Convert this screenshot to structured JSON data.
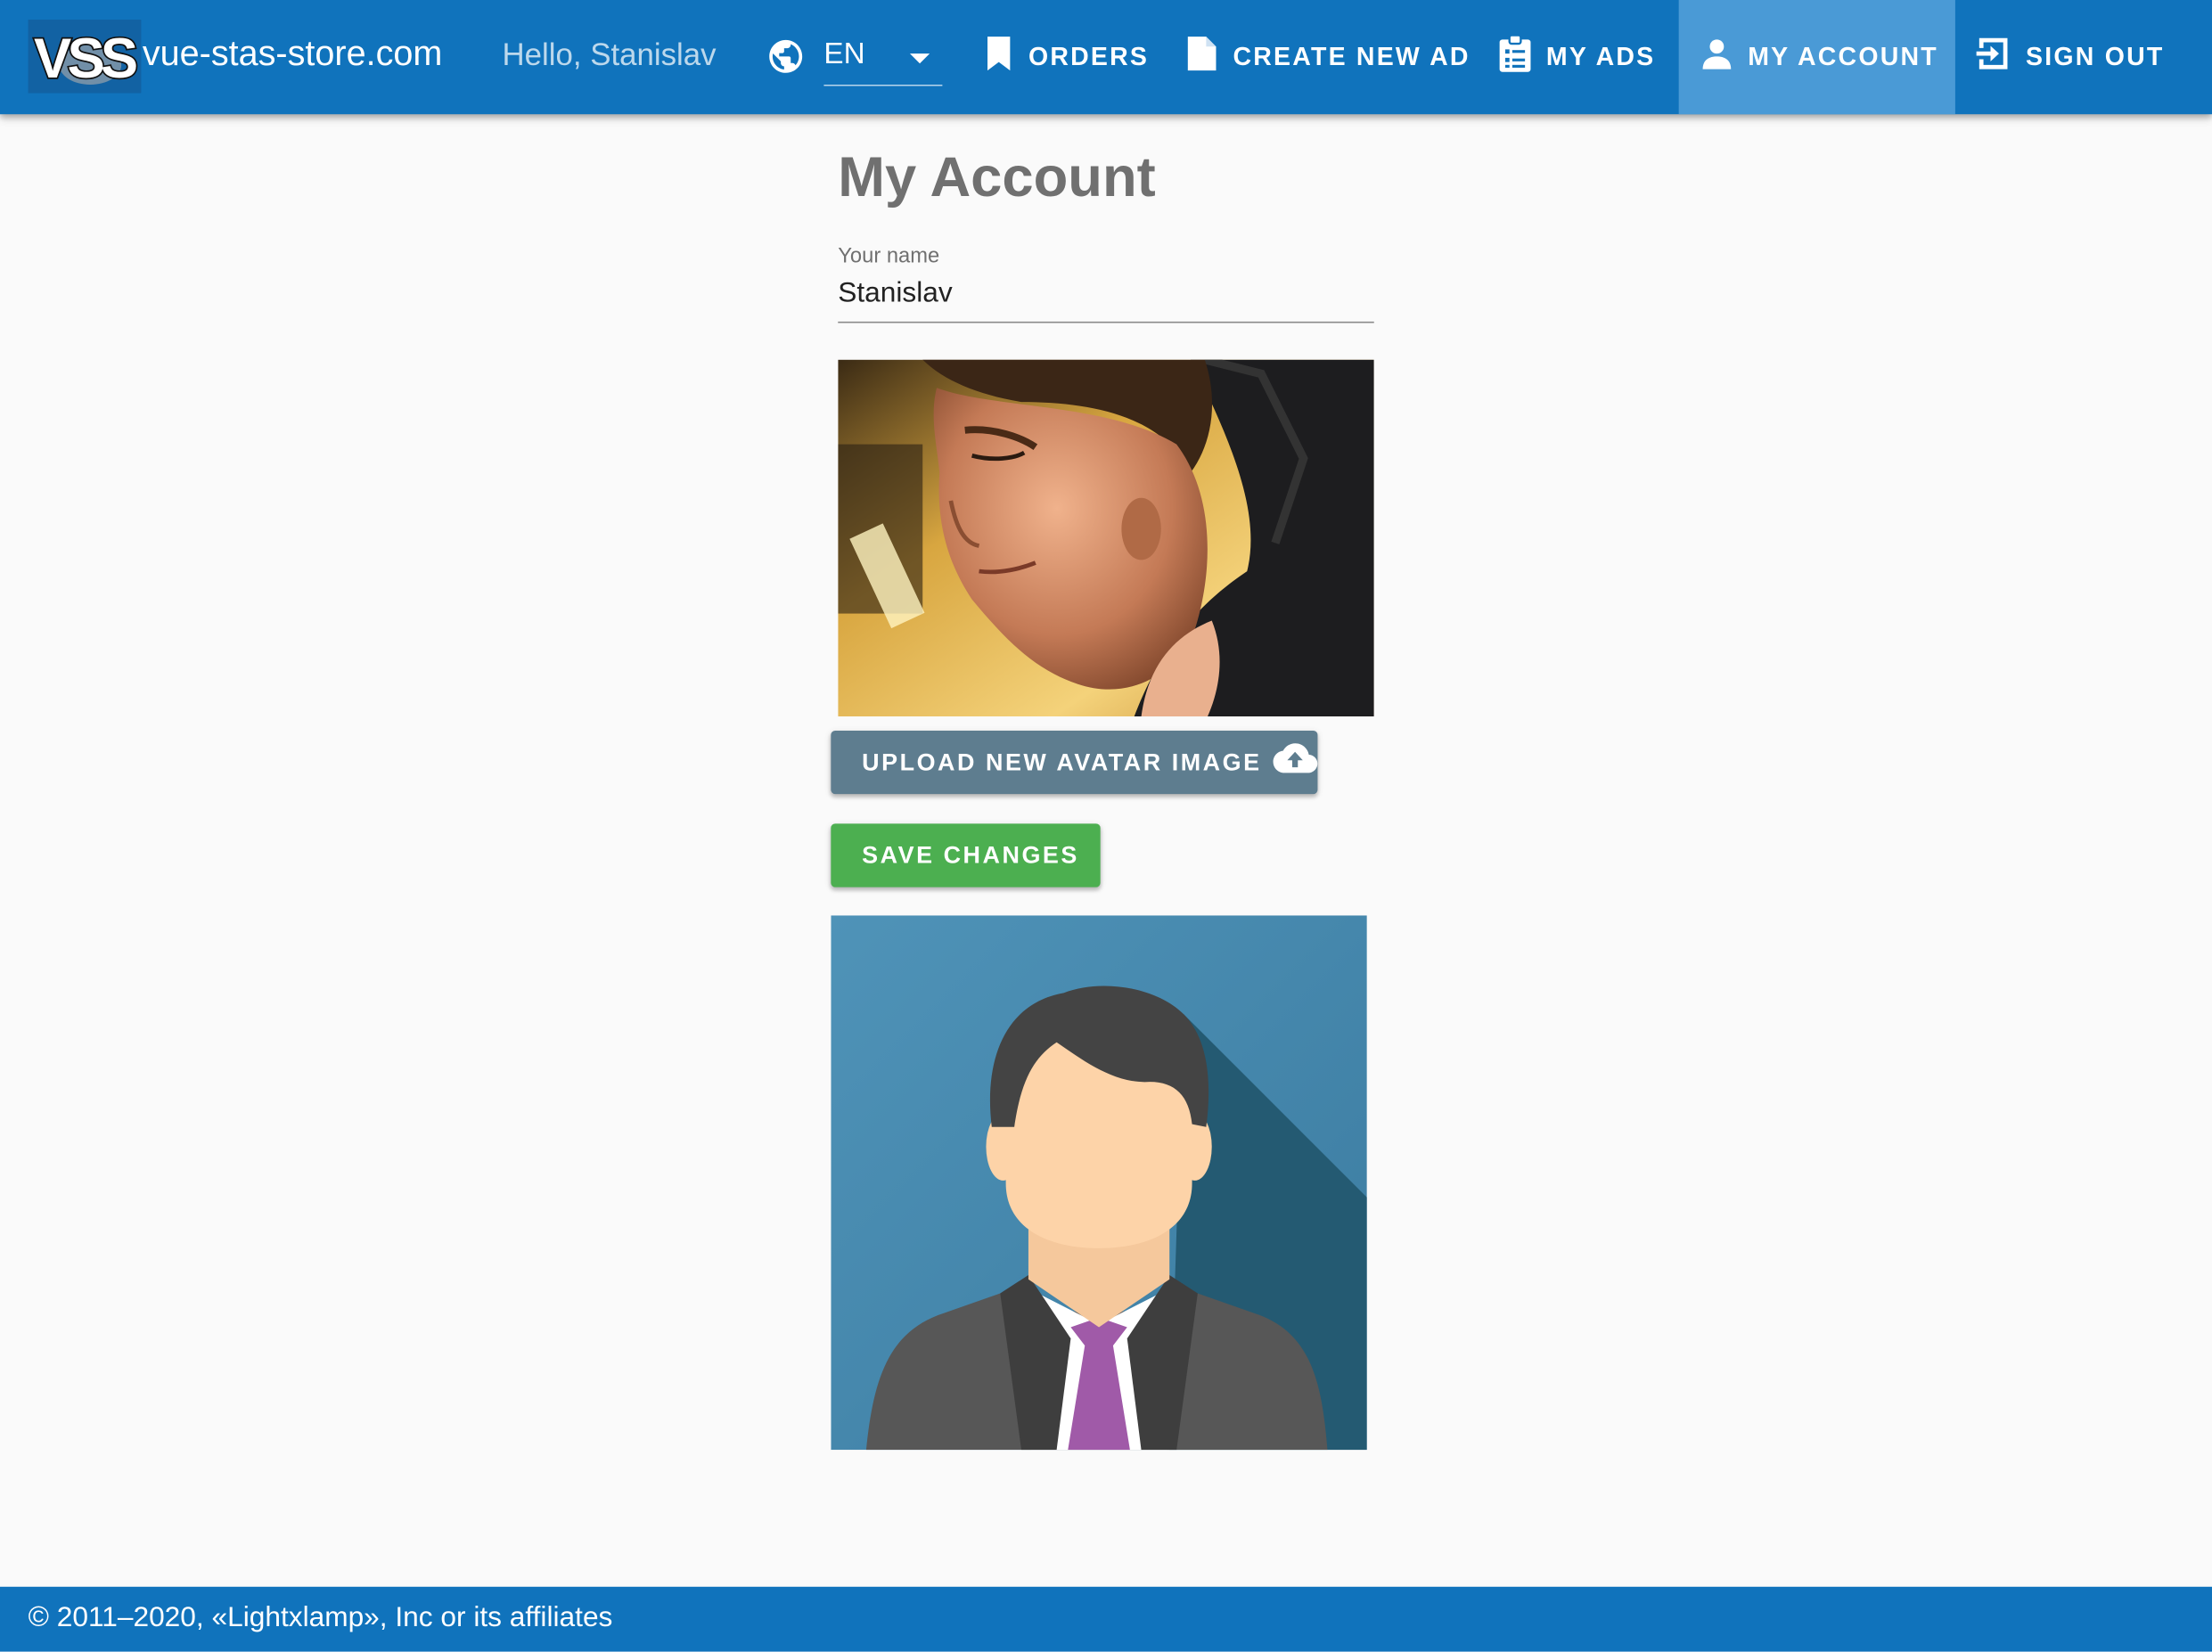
{
  "header": {
    "logo_text": "VSS",
    "brand": "vue-stas-store.com",
    "greeting": "Hello, Stanislav",
    "language": {
      "selected": "EN"
    },
    "nav": [
      {
        "label": "ORDERS",
        "icon": "bookmark-icon"
      },
      {
        "label": "CREATE NEW AD",
        "icon": "file-icon"
      },
      {
        "label": "MY ADS",
        "icon": "clipboard-list-icon"
      },
      {
        "label": "MY ACCOUNT",
        "icon": "account-icon",
        "active": true
      },
      {
        "label": "SIGN OUT",
        "icon": "exit-icon"
      }
    ]
  },
  "main": {
    "title": "My Account",
    "name_field": {
      "label": "Your name",
      "value": "Stanislav"
    },
    "upload_button": "UPLOAD NEW AVATAR IMAGE",
    "save_button": "SAVE CHANGES"
  },
  "footer": {
    "text": "© 2011–2020, «Lightxlamp», Inc or its affiliates"
  },
  "colors": {
    "primary": "#1073bc",
    "nav_active": "#4a9ad6",
    "upload_button": "#5e7d8f",
    "save_button": "#4caf50",
    "avatar_background": "#4a8fb4"
  }
}
